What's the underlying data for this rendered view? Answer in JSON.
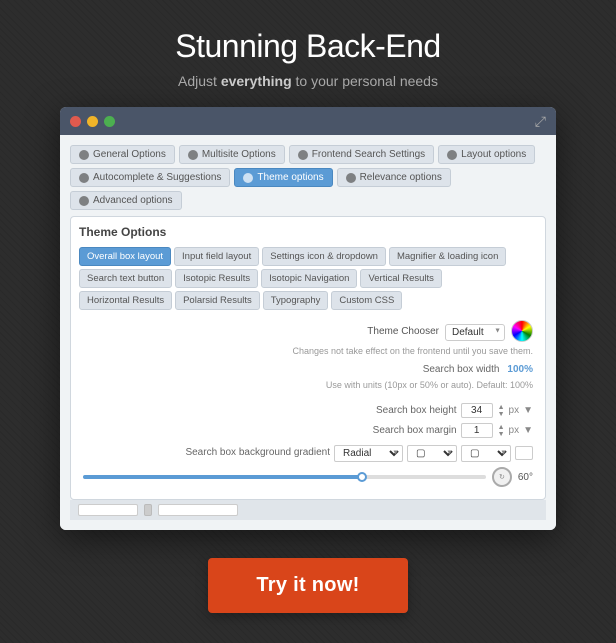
{
  "header": {
    "title": "Stunning Back-End",
    "subtitle_before": "Adjust ",
    "subtitle_bold": "everything",
    "subtitle_after": " to your personal needs"
  },
  "browser": {
    "expand_icon": "⤢"
  },
  "nav_tabs_row1": [
    {
      "label": "General Options",
      "icon": true,
      "active": false
    },
    {
      "label": "Multisite Options",
      "icon": true,
      "active": false
    },
    {
      "label": "Frontend Search Settings",
      "icon": true,
      "active": false
    },
    {
      "label": "Layout options",
      "icon": true,
      "active": false
    }
  ],
  "nav_tabs_row2": [
    {
      "label": "Autocomplete & Suggestions",
      "icon": true,
      "active": false
    },
    {
      "label": "Theme options",
      "icon": true,
      "active": true
    },
    {
      "label": "Relevance options",
      "icon": true,
      "active": false
    },
    {
      "label": "Advanced options",
      "icon": true,
      "active": false
    }
  ],
  "theme_section": {
    "title": "Theme Options",
    "sub_tabs": [
      {
        "label": "Overall box layout",
        "active": true
      },
      {
        "label": "Input field layout",
        "active": false
      },
      {
        "label": "Settings icon & dropdown",
        "active": false
      },
      {
        "label": "Magnifier & loading icon",
        "active": false
      },
      {
        "label": "Search text button",
        "active": false
      },
      {
        "label": "Isotopic Results",
        "active": false
      },
      {
        "label": "Isotopic Navigation",
        "active": false
      },
      {
        "label": "Vertical Results",
        "active": false
      },
      {
        "label": "Horizontal Results",
        "active": false
      },
      {
        "label": "Polarsid Results",
        "active": false
      },
      {
        "label": "Typography",
        "active": false
      },
      {
        "label": "Custom CSS",
        "active": false
      }
    ]
  },
  "form": {
    "theme_chooser_label": "Theme Chooser",
    "theme_chooser_value": "Default",
    "hint": "Changes not take effect on the frontend until you save them.",
    "search_box_width_label": "Search box width",
    "search_box_width_value": "100%",
    "search_box_width_hint": "Use with units (10px or 50% or auto). Default: 100%",
    "search_box_height_label": "Search box height",
    "search_box_height_value": "34",
    "search_box_margin_label": "Search box margin",
    "search_box_margin_value": "1",
    "unit_px": "px",
    "gradient_label": "Search box background gradient",
    "gradient_type": "Radial",
    "rotation_value": "60",
    "rotation_symbol": "°"
  },
  "cta": {
    "label": "Try it now!"
  }
}
